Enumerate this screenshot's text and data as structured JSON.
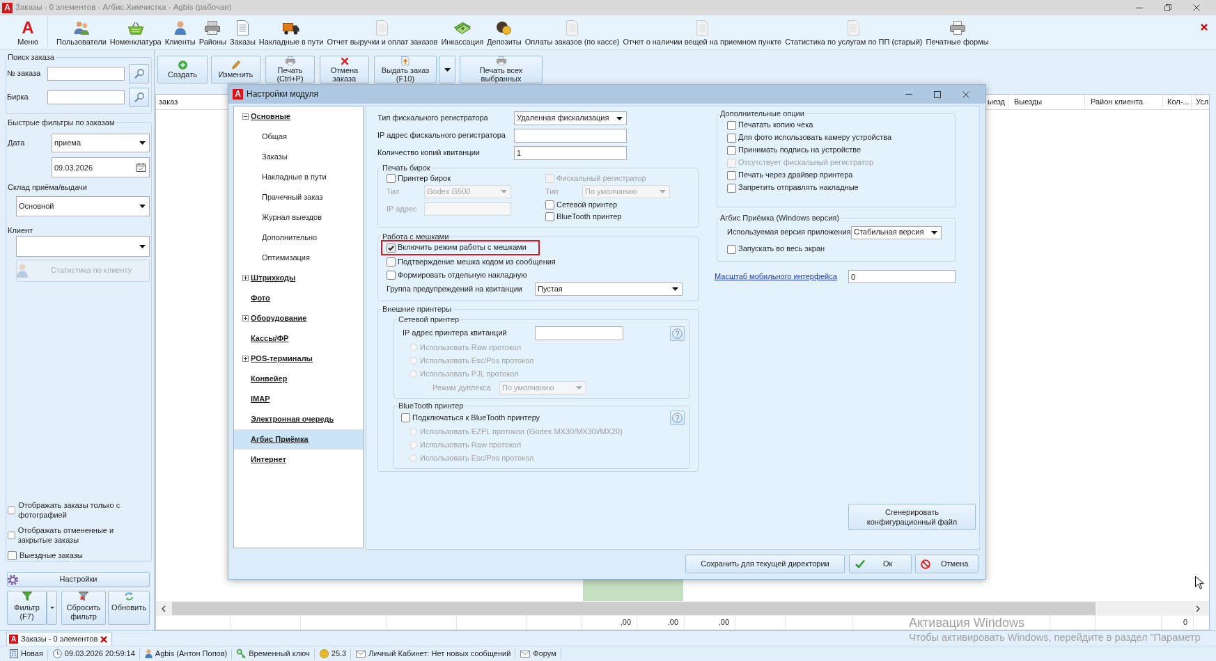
{
  "window": {
    "logo": "A",
    "title": "Заказы - 0 элементов - Агбис.Химчистка - Agbis (рабочая)"
  },
  "ribbon": {
    "menu": {
      "logo": "A",
      "label": "Меню"
    },
    "items": [
      {
        "label": "Пользователи"
      },
      {
        "label": "Номенклатура"
      },
      {
        "label": "Клиенты"
      },
      {
        "label": "Районы"
      },
      {
        "label": "Заказы"
      },
      {
        "label": "Накладные в пути"
      },
      {
        "label": "Отчет выручки и оплат заказов"
      },
      {
        "label": "Инкассация"
      },
      {
        "label": "Депозиты"
      },
      {
        "label": "Оплаты заказов (по кассе)"
      },
      {
        "label": "Отчет о наличии вещей на приемном пункте"
      },
      {
        "label": "Статистика по услугам по ПП (старый)"
      },
      {
        "label": "Печатные формы"
      }
    ]
  },
  "order_search": {
    "title": "Поиск заказа",
    "fields": [
      {
        "label": "№ заказа"
      },
      {
        "label": "Бирка"
      }
    ]
  },
  "quick_filters": {
    "title": "Быстрые фильтры по заказам",
    "date_label": "Дата",
    "date_kind": "приема",
    "date": "09.03.2026",
    "warehouse_label": "Склад приёма/выдачи",
    "warehouse": "Основной",
    "client_label": "Клиент",
    "client_stats": {
      "label": "Статистика по клиенту",
      "disabled": true
    },
    "options": [
      {
        "label": "Отображать заказы только с фотографией",
        "checked": false
      },
      {
        "label": "Отображать отмененные и закрытые заказы",
        "checked": false
      },
      {
        "label": "Выездные заказы",
        "checked": false
      }
    ]
  },
  "settings_button": {
    "label": "Настройки"
  },
  "filter_buttons": [
    {
      "label": "Фильтр (F7)",
      "kind": "split"
    },
    {
      "label": "Сбросить фильтр",
      "kind": "plain"
    },
    {
      "label": "Обновить",
      "kind": "plain"
    }
  ],
  "toolbar": [
    {
      "label": "Создать",
      "kind": "plain"
    },
    {
      "label": "Изменить",
      "kind": "plain"
    },
    {
      "label": "Печать (Ctrl+P)",
      "kind": "plain"
    },
    {
      "label": "Отмена заказа",
      "kind": "plain"
    },
    {
      "label": "Выдать заказ (F10)",
      "kind": "split"
    },
    {
      "label": "Печать всех выбранных",
      "kind": "plain"
    }
  ],
  "grid": {
    "columns": [
      {
        "label": "заказ"
      },
      {
        "label": "ыезд"
      },
      {
        "label": "Выезды"
      },
      {
        "label": "Район клиента"
      },
      {
        "label": "Кол-..."
      },
      {
        "label": "Усл"
      }
    ],
    "totals": [
      ",00",
      ",00",
      ",00",
      "0"
    ]
  },
  "document_tabs": [
    {
      "logo": "A",
      "label": "Заказы - 0 элементов",
      "selected": true
    }
  ],
  "status_bar": [
    {
      "text": "Новая"
    },
    {
      "text": "09.03.2026 20:59:14"
    },
    {
      "text": "Agbis (Антон Попов)"
    },
    {
      "text": "Временный ключ"
    },
    {
      "text": "25.3"
    },
    {
      "text": "Личный Кабинет: Нет новых сообщений"
    },
    {
      "text": "Форум"
    }
  ],
  "windows_activation": {
    "title": "Активация Windows",
    "text": "Чтобы активировать Windows, перейдите в раздел \"Параметр"
  },
  "dialog": {
    "logo": "A",
    "title": "Настройки модуля",
    "nav": [
      {
        "label": "Основные",
        "kind": "group",
        "expanded": true,
        "selected": false,
        "children": [
          {
            "label": "Общая",
            "selected": false
          },
          {
            "label": "Заказы",
            "selected": false
          },
          {
            "label": "Накладные в пути",
            "selected": false
          },
          {
            "label": "Прачечный заказ",
            "selected": false
          },
          {
            "label": "Журнал выездов",
            "selected": false
          },
          {
            "label": "Дополнительно",
            "selected": false
          },
          {
            "label": "Оптимизация",
            "selected": false
          }
        ]
      },
      {
        "label": "Штрихкоды",
        "kind": "group",
        "expanded": false,
        "selected": false
      },
      {
        "label": "Фото",
        "kind": "page",
        "selected": false
      },
      {
        "label": "Оборудование",
        "kind": "group",
        "expanded": false,
        "selected": false
      },
      {
        "label": "Кассы/ФР",
        "kind": "page",
        "selected": false
      },
      {
        "label": "POS-терминалы",
        "kind": "group",
        "expanded": false,
        "selected": false
      },
      {
        "label": "Конвейер",
        "kind": "page",
        "selected": false
      },
      {
        "label": "IMAP",
        "kind": "page",
        "selected": false
      },
      {
        "label": "Электронная очередь",
        "kind": "page",
        "selected": false
      },
      {
        "label": "Агбис Приёмка",
        "kind": "page",
        "selected": true
      },
      {
        "label": "Интернет",
        "kind": "page",
        "selected": false
      }
    ],
    "fields": [
      {
        "label": "Тип фискального регистратора",
        "kind": "select",
        "value": "Удаленная фискализация"
      },
      {
        "label": "IP адрес фискального регистратора",
        "kind": "input"
      },
      {
        "label": "Количество копий квитанции",
        "kind": "input",
        "value": "1"
      }
    ],
    "tag_printing": {
      "title": "Печать бирок",
      "left": [
        {
          "kind": "checkbox",
          "label": "Принтер бирок",
          "checked": false,
          "disabled": false
        },
        {
          "kind": "select",
          "label": "Тип",
          "value": "Godex G500",
          "disabled": true
        },
        {
          "kind": "input",
          "label": "IP адрес",
          "disabled": true
        }
      ],
      "right": [
        {
          "kind": "checkbox",
          "label": "Фискальный регистратор",
          "checked": false,
          "disabled": true
        },
        {
          "kind": "select",
          "label": "Тип",
          "value": "По умолчанию",
          "disabled": true
        },
        {
          "kind": "checkbox",
          "label": "Сетевой принтер",
          "checked": false,
          "disabled": false
        },
        {
          "kind": "checkbox",
          "label": "BlueTooth принтер",
          "checked": false,
          "disabled": false
        }
      ]
    },
    "bags": {
      "title": "Работа с мешками",
      "options": [
        {
          "label": "Включить режим работы с мешками",
          "checked": true,
          "highlighted": true
        },
        {
          "label": "Подтверждение мешка кодом из сообщения",
          "checked": false,
          "highlighted": false
        },
        {
          "label": "Формировать отдельную накладную",
          "checked": false,
          "highlighted": false
        }
      ],
      "warning_group": {
        "label": "Группа предупреждений на квитанции",
        "value": "Пустая"
      }
    },
    "external_printers": {
      "title": "Внешние принтеры",
      "network": {
        "title": "Сетевой принтер",
        "ip_label": "IP адрес принтера квитанций",
        "protocols": [
          {
            "label": "Использовать Raw протокол",
            "selected": false,
            "disabled": true
          },
          {
            "label": "Использовать Esc/Pos протокол",
            "selected": false,
            "disabled": true
          },
          {
            "label": "Использовать PJL протокол",
            "selected": false,
            "disabled": true
          }
        ],
        "duplex": {
          "label": "Режим дуплекса",
          "value": "По умолчанию",
          "disabled": true
        }
      },
      "bluetooth": {
        "title": "BlueTooth принтер",
        "connect": {
          "label": "Подключаться к BlueTooth принтеру",
          "checked": false
        },
        "protocols": [
          {
            "label": "Использовать EZPL протокол (Godex MX30/MX30i/MX20)",
            "selected": false,
            "disabled": true
          },
          {
            "label": "Использовать Raw протокол",
            "selected": false,
            "disabled": true
          },
          {
            "label": "Использовать Esc/Pos протокол",
            "selected": false,
            "disabled": true
          }
        ]
      }
    },
    "extra_options": {
      "title": "Дополнительные опции",
      "options": [
        {
          "label": "Печатать копию чека",
          "checked": false,
          "disabled": false
        },
        {
          "label": "Для фото использовать камеру устройства",
          "checked": false,
          "disabled": false
        },
        {
          "label": "Принимать подпись на устройстве",
          "checked": false,
          "disabled": false
        },
        {
          "label": "Отсутствует фискальный регистратор",
          "checked": false,
          "disabled": true
        },
        {
          "label": "Печать через драйвер принтера",
          "checked": false,
          "disabled": false
        },
        {
          "label": "Запретить отправлять накладные",
          "checked": false,
          "disabled": false
        }
      ]
    },
    "windows_app": {
      "title": "Агбис Приёмка (Windows версия)",
      "version": {
        "label": "Используемая версия приложения",
        "value": "Стабильная версия"
      },
      "fullscreen": {
        "label": "Запускать во весь экран",
        "checked": false
      }
    },
    "mobile_scale": {
      "label": "Масштаб мобильного интерфейса",
      "value": "0"
    },
    "generate_button": {
      "label": "Сгенерировать конфигурационный файл"
    },
    "buttons": [
      {
        "label": "Сохранить для текущей директории",
        "kind": "plain"
      },
      {
        "label": "Ок",
        "kind": "ok"
      },
      {
        "label": "Отмена",
        "kind": "cancel"
      }
    ]
  }
}
